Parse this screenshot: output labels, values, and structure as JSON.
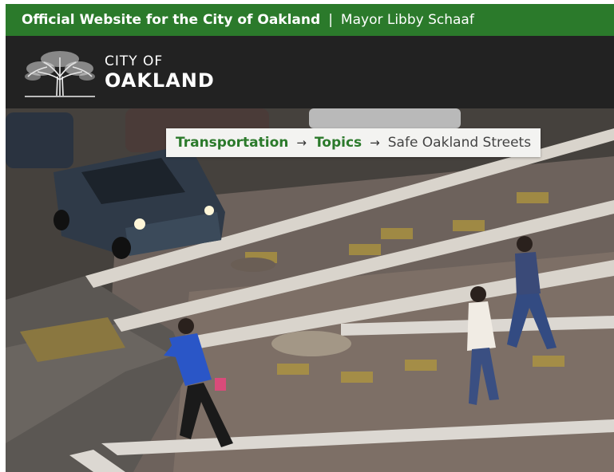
{
  "topbar": {
    "official": "Official Website for the City of Oakland",
    "separator": "|",
    "mayor": "Mayor Libby Schaaf",
    "color": "#2b7a2b"
  },
  "header": {
    "logo_line1": "CITY OF",
    "logo_line2": "OAKLAND",
    "logo_icon": "oak-tree-icon",
    "background": "#222222"
  },
  "breadcrumb": {
    "items": [
      {
        "label": "Transportation"
      },
      {
        "label": "Topics"
      }
    ],
    "arrow": "→",
    "current": "Safe Oakland Streets"
  },
  "hero": {
    "image": "crosswalk-street-scene"
  }
}
